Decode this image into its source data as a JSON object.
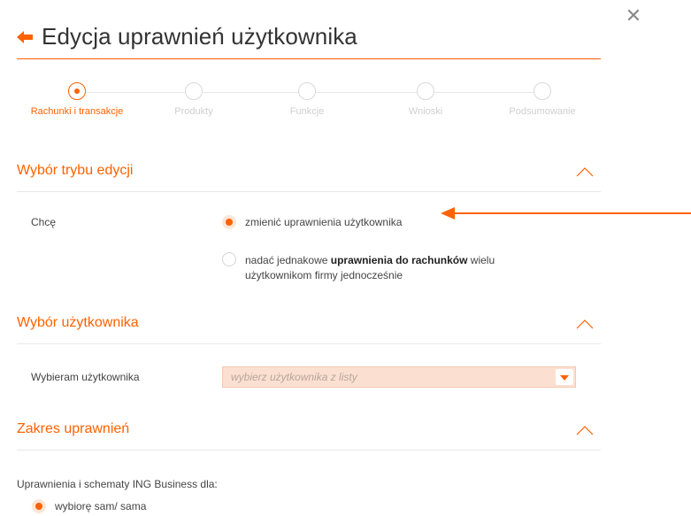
{
  "dialog": {
    "title": "Edycja uprawnień użytkownika",
    "close_glyph": "✕"
  },
  "stepper": {
    "steps": [
      {
        "label": "Rachunki i transakcje",
        "active": true
      },
      {
        "label": "Produkty",
        "active": false
      },
      {
        "label": "Funkcje",
        "active": false
      },
      {
        "label": "Wnioski",
        "active": false
      },
      {
        "label": "Podsumowanie",
        "active": false
      }
    ]
  },
  "section_mode": {
    "title": "Wybór trybu edycji",
    "row_label": "Chcę",
    "options": [
      {
        "text": "zmienić uprawnienia użytkownika",
        "checked": true
      },
      {
        "text_before": "nadać jednakowe ",
        "text_bold": "uprawnienia do rachunków",
        "text_after": " wielu użytkownikom firmy jednocześnie",
        "checked": false
      }
    ]
  },
  "section_user": {
    "title": "Wybór użytkownika",
    "row_label": "Wybieram użytkownika",
    "select_placeholder": "wybierz użytkownika z listy"
  },
  "section_scope": {
    "title": "Zakres uprawnień",
    "intro": "Uprawnienia i schematy ING Business dla:",
    "option": {
      "text": "wybiorę sam/ sama",
      "checked": true
    }
  },
  "colors": {
    "accent": "#ff6200",
    "select_bg": "#fbe0d1",
    "muted": "#cfcfcf"
  }
}
